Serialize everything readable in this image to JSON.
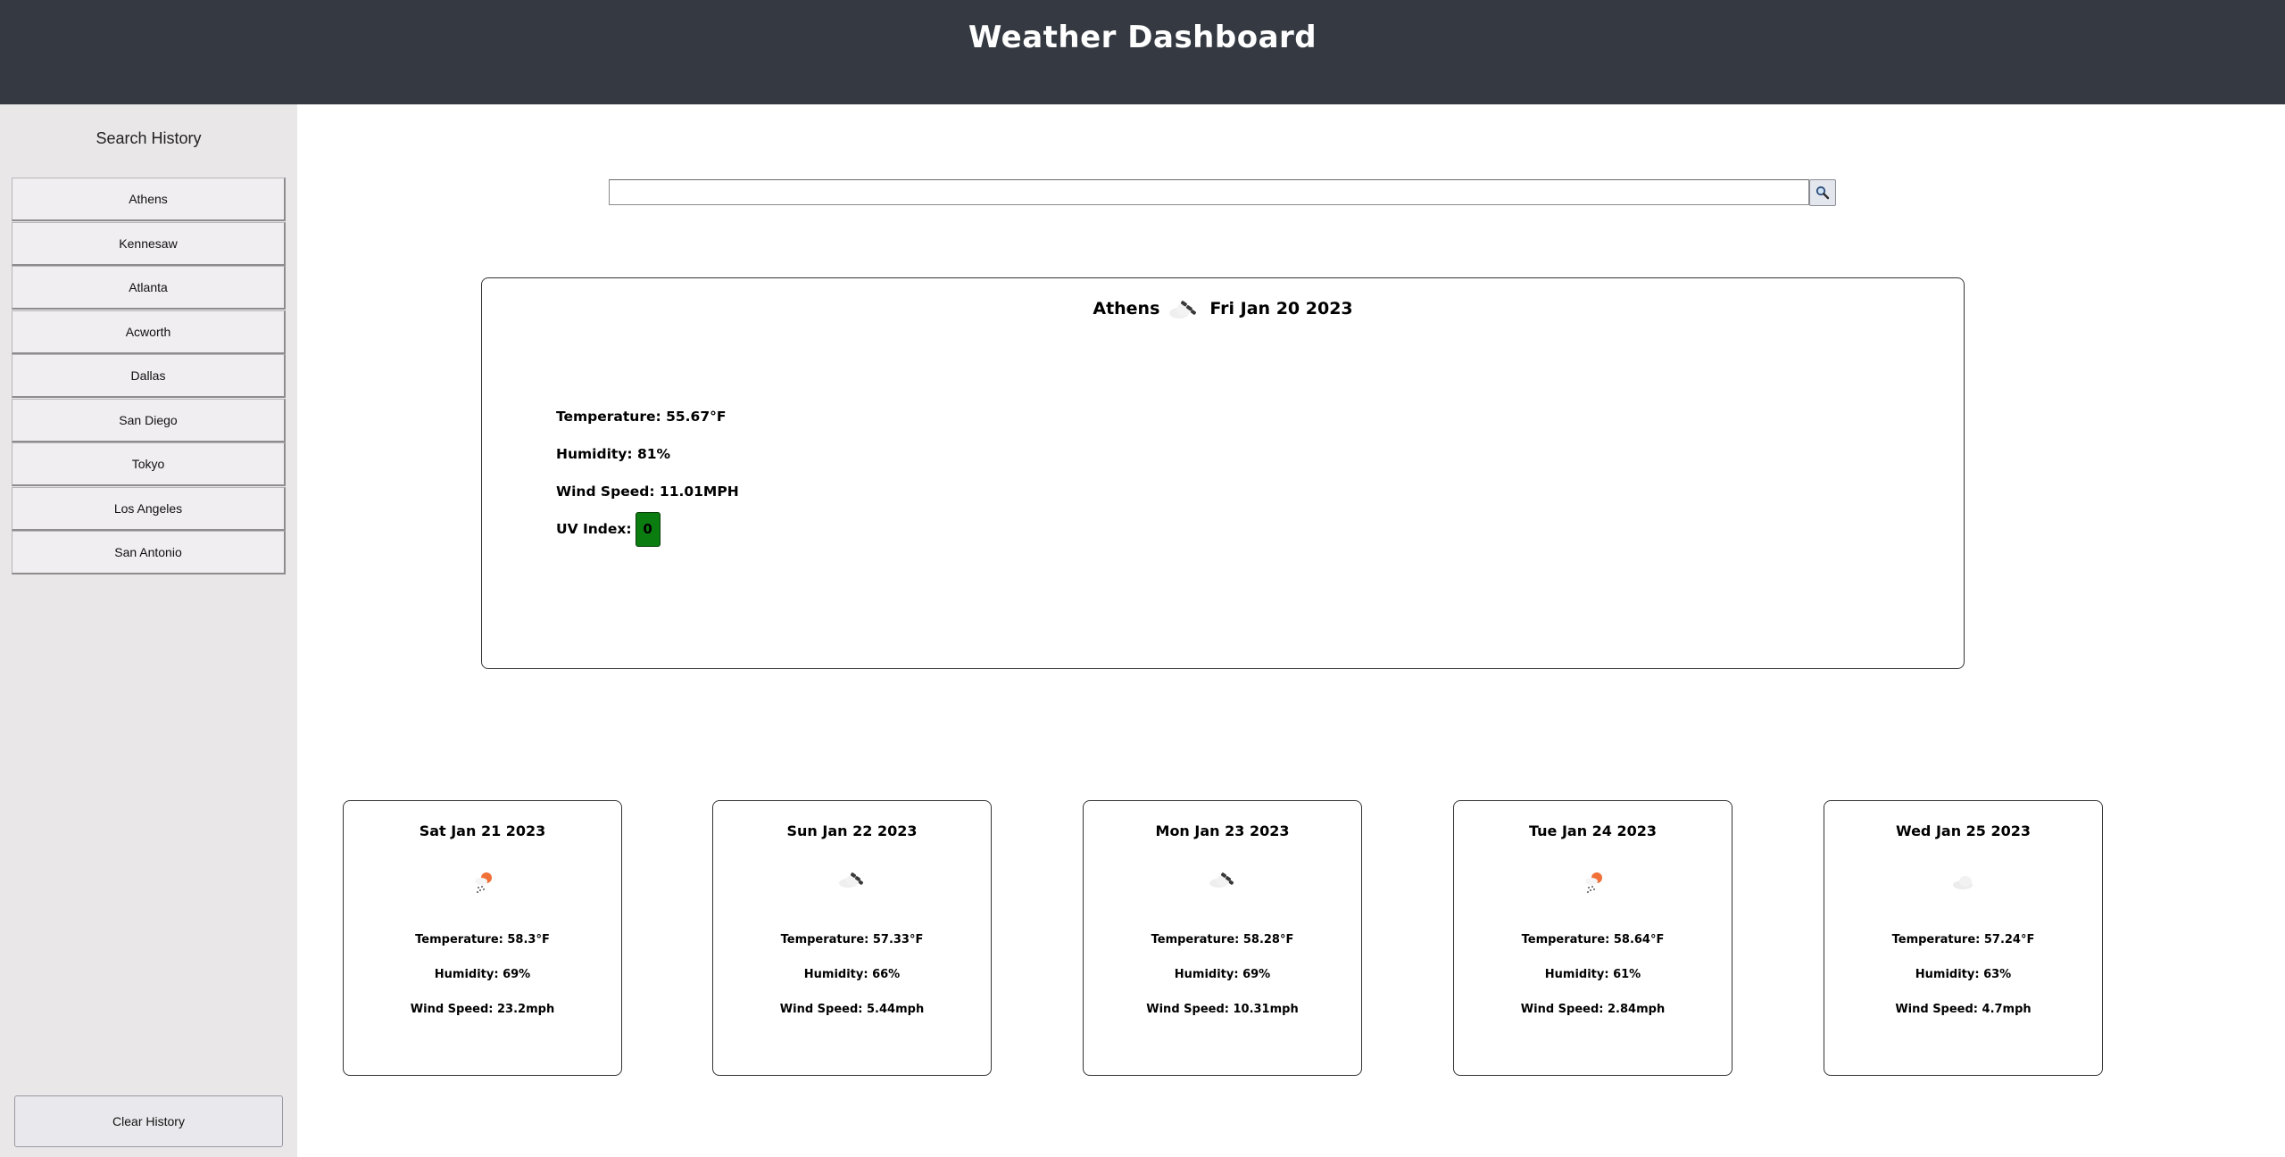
{
  "header": {
    "title": "Weather Dashboard"
  },
  "sidebar": {
    "title": "Search History",
    "items": [
      "Athens",
      "Kennesaw",
      "Atlanta",
      "Acworth",
      "Dallas",
      "San Diego",
      "Tokyo",
      "Los Angeles",
      "San Antonio"
    ],
    "clear_label": "Clear History"
  },
  "search": {
    "value": "",
    "placeholder": "",
    "button_icon": "search-icon"
  },
  "current": {
    "city": "Athens",
    "date": "Fri Jan 20 2023",
    "icon": "cloud-wind-icon",
    "temperature": "Temperature: 55.67°F",
    "humidity": "Humidity: 81%",
    "wind": "Wind Speed: 11.01MPH",
    "uv_label": "UV Index:",
    "uv_value": "0",
    "uv_color": "#0b7d10"
  },
  "forecast": [
    {
      "date": "Sat Jan 21 2023",
      "icon": "sun-rain-icon",
      "temperature": "Temperature: 58.3°F",
      "humidity": "Humidity: 69%",
      "wind": "Wind Speed: 23.2mph"
    },
    {
      "date": "Sun Jan 22 2023",
      "icon": "cloud-wind-icon",
      "temperature": "Temperature: 57.33°F",
      "humidity": "Humidity: 66%",
      "wind": "Wind Speed: 5.44mph"
    },
    {
      "date": "Mon Jan 23 2023",
      "icon": "cloud-wind-icon",
      "temperature": "Temperature: 58.28°F",
      "humidity": "Humidity: 69%",
      "wind": "Wind Speed: 10.31mph"
    },
    {
      "date": "Tue Jan 24 2023",
      "icon": "sun-rain-icon",
      "temperature": "Temperature: 58.64°F",
      "humidity": "Humidity: 61%",
      "wind": "Wind Speed: 2.84mph"
    },
    {
      "date": "Wed Jan 25 2023",
      "icon": "cloud-icon",
      "temperature": "Temperature: 57.24°F",
      "humidity": "Humidity: 63%",
      "wind": "Wind Speed: 4.7mph"
    }
  ]
}
